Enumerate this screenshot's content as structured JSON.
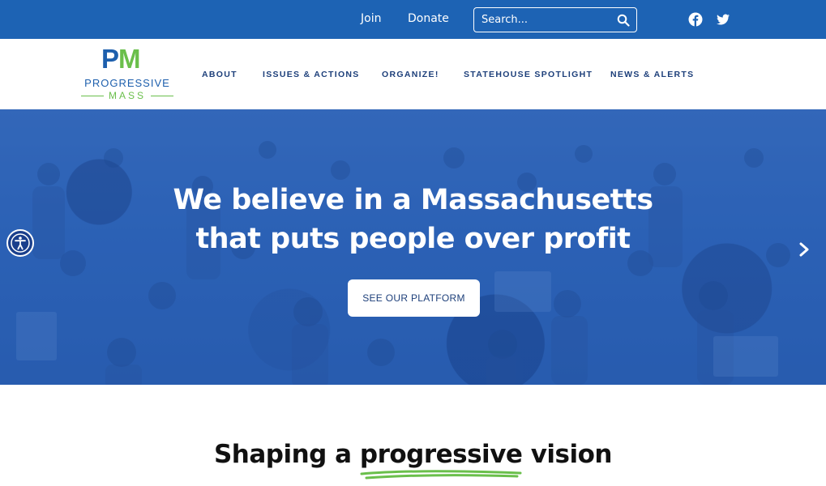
{
  "topbar": {
    "join_label": "Join",
    "donate_label": "Donate",
    "search_placeholder": "Search...",
    "search_icon": "search-icon",
    "social_icons": [
      "facebook-icon",
      "twitter-icon"
    ]
  },
  "logo": {
    "mark_p": "P",
    "mark_m": "M",
    "line1": "PROGRESSIVE",
    "line2": "MASS"
  },
  "nav": {
    "items": [
      {
        "label": "ABOUT"
      },
      {
        "label": "ISSUES & ACTIONS"
      },
      {
        "label": "ORGANIZE!"
      },
      {
        "label": "STATEHOUSE SPOTLIGHT"
      },
      {
        "label": "NEWS & ALERTS"
      }
    ]
  },
  "hero": {
    "title_line1": "We believe in a Massachusetts",
    "title_line2": "that puts people over profit",
    "button_label": "SEE OUR PLATFORM",
    "accessibility_icon": "accessibility-icon",
    "next_icon": "chevron-right-icon"
  },
  "section": {
    "title": "Shaping a progressive vision"
  },
  "colors": {
    "brand_blue": "#1d63b4",
    "brand_green": "#6abf4b",
    "nav_text": "#1d3f7a"
  }
}
